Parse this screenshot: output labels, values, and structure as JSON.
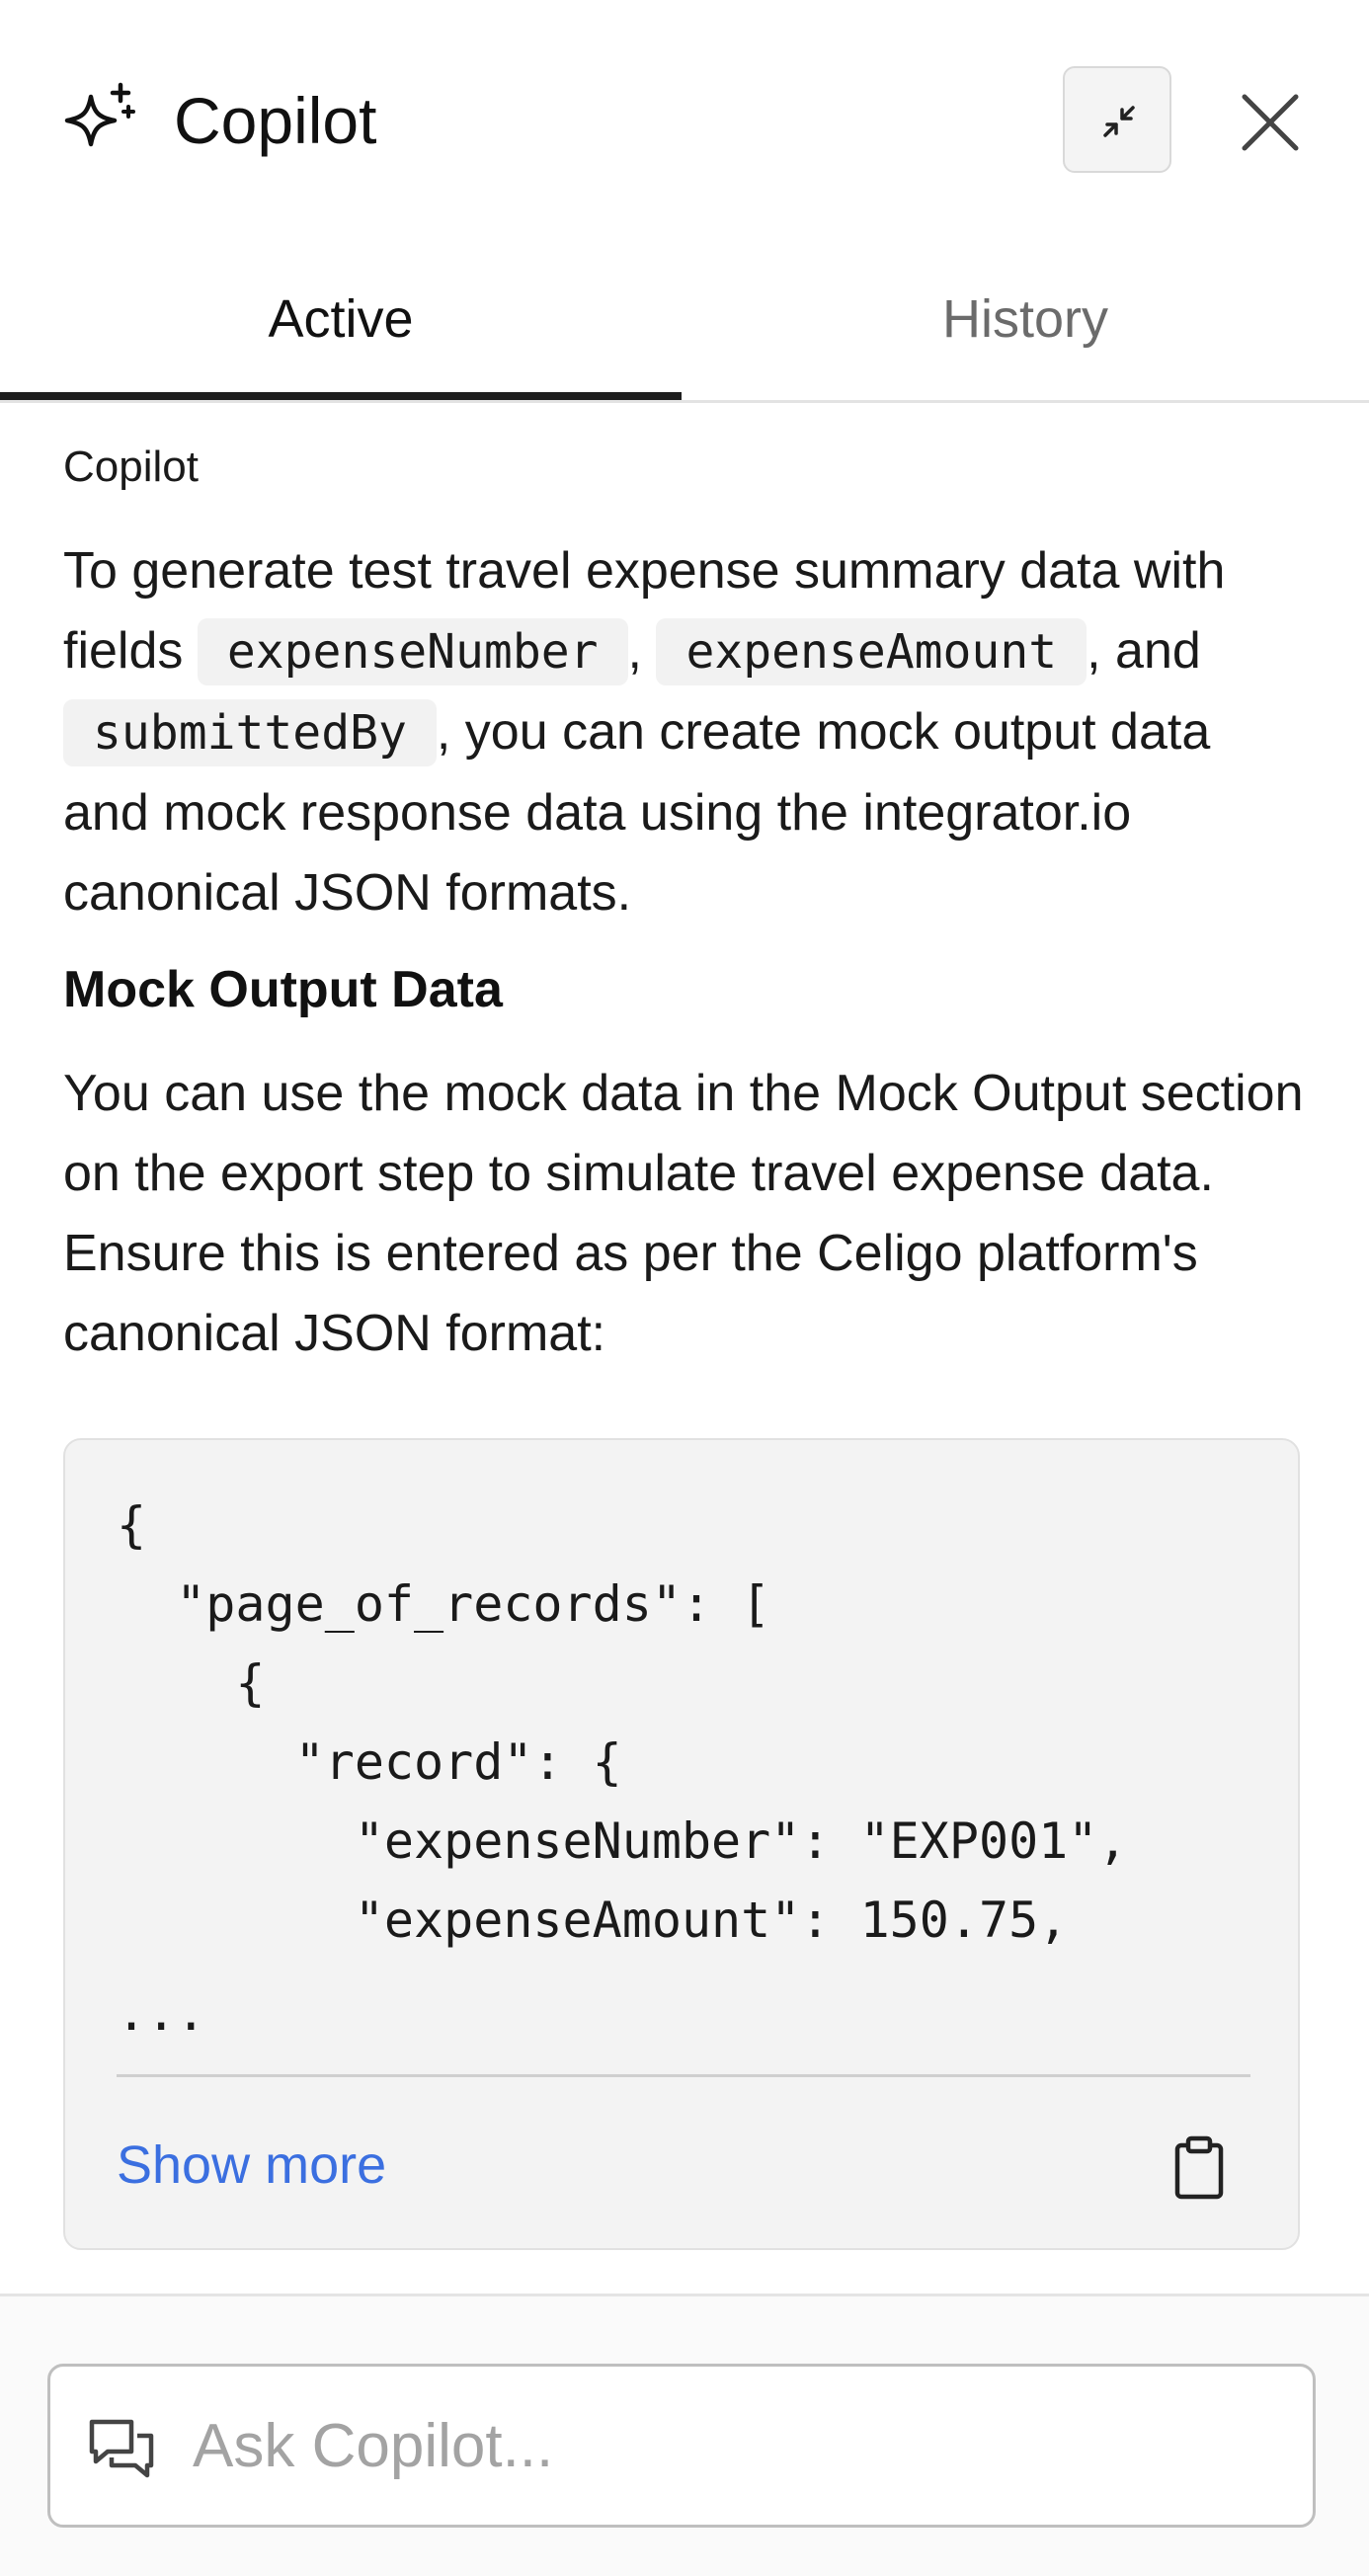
{
  "header": {
    "title": "Copilot",
    "icons": {
      "logo": "sparkles-icon",
      "collapse": "collapse-arrows-icon",
      "close": "close-icon"
    }
  },
  "tabs": [
    {
      "label": "Active",
      "active": true
    },
    {
      "label": "History",
      "active": false
    }
  ],
  "message": {
    "sender": "Copilot",
    "intro": {
      "text_1": "To generate test travel expense summary data with fields ",
      "code_1": "expenseNumber",
      "text_2": ", ",
      "code_2": "expenseAmount",
      "text_3": ", and ",
      "code_3": "submittedBy",
      "text_4": ", you can create mock output data and mock response data using the integrator.io canonical JSON formats."
    },
    "section_heading": "Mock Output Data",
    "body": "You can use the mock data in the Mock Output section on the export step to simulate travel expense data. Ensure this is entered as per the Celigo platform's canonical JSON format:",
    "code_block": {
      "lines": [
        "{",
        "  \"page_of_records\": [",
        "    {",
        "      \"record\": {",
        "        \"expenseNumber\": \"EXP001\",",
        "        \"expenseAmount\": 150.75,"
      ],
      "ellipsis": "...",
      "show_more_label": "Show more",
      "copy_icon": "clipboard-icon"
    }
  },
  "input": {
    "placeholder": "Ask Copilot...",
    "value": "",
    "icon": "chat-bubbles-icon"
  },
  "colors": {
    "link": "#3b6fe0",
    "active_tab_underline": "#1e1e1e",
    "code_background": "#f3f3f3",
    "muted_text": "#6b6b6b"
  }
}
